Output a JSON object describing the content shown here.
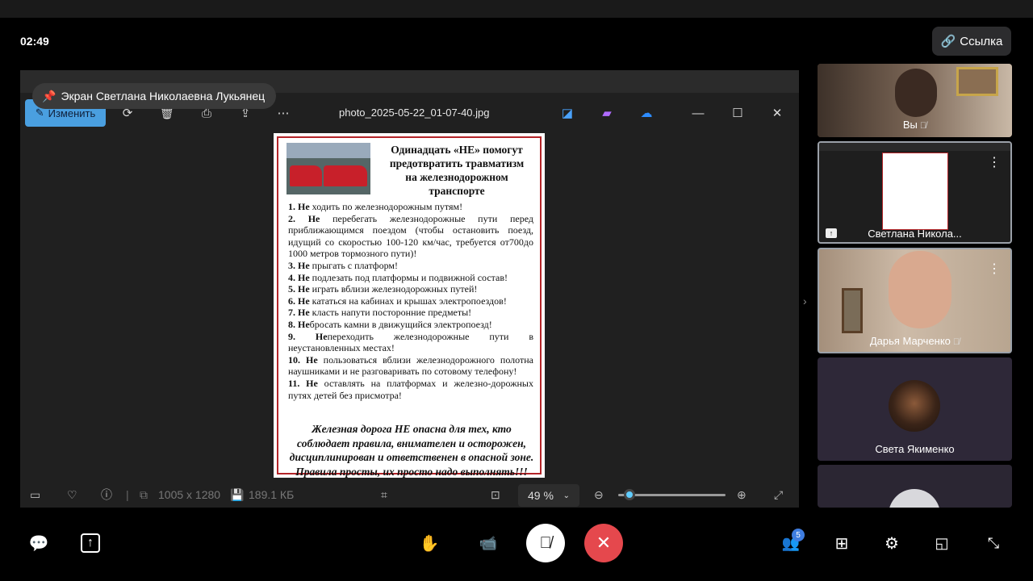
{
  "call": {
    "elapsed_time": "02:49",
    "link_button_label": "Ссылка",
    "screen_share_label": "Экран Светлана Николаевна Лукьянец"
  },
  "viewer": {
    "edit_label": "Изменить",
    "file_name": "photo_2025-05-22_01-07-40.jpg",
    "dimensions": "1005 x 1280",
    "file_size": "189.1 КБ",
    "zoom": "49 %",
    "zoom_slider_fraction": 0.05
  },
  "poster": {
    "title_lines": [
      "Одинадцать «НЕ» помогут",
      "предотвратить травматизм",
      "на железнодорожном",
      "транспорте"
    ],
    "rules": [
      {
        "num": "1.",
        "bold": "Не",
        "text": " ходить по железнодорожным путям!"
      },
      {
        "num": "2.",
        "bold": "Не",
        "text": " перебегать железнодорожные пути перед приближающимся поездом (чтобы остановить поезд, идущий со скоростью 100-120 км/час, требуется от700до 1000 метров тормозного пути)!"
      },
      {
        "num": "3.",
        "bold": "Не",
        "text": " прыгать с платформ!"
      },
      {
        "num": "4.",
        "bold": "Не",
        "text": " подлезать под платформы и подвижной состав!"
      },
      {
        "num": "5.",
        "bold": "Не",
        "text": " играть вблизи железнодорожных путей!"
      },
      {
        "num": "6.",
        "bold": "Не",
        "text": " кататься на кабинах и крышах электропоездов!"
      },
      {
        "num": "7.",
        "bold": "Не",
        "text": " класть напути посторонние предметы!"
      },
      {
        "num": "8.",
        "bold": "Не",
        "text": "бросать камни в движущийся электропоезд!"
      },
      {
        "num": "9.",
        "bold": "Не",
        "text": "переходить железнодорожные пути в неустановленных местах!"
      },
      {
        "num": "10.",
        "bold": "Не",
        "text": " пользоваться вблизи железнодорожного полотна наушниками и не разговаривать по сотовому телефону!"
      },
      {
        "num": "11.",
        "bold": "Не",
        "text": " оставлять на платформах и железно-дорожных путях детей без присмотра!"
      }
    ],
    "footer_lines": [
      "Железная дорога НЕ опасна для тех, кто",
      "соблюдает правила, внимателен и осторожен,",
      "дисциплинирован и ответственен в опасной зоне.",
      "Правила просты, их просто надо выполнять!!!"
    ]
  },
  "participants": [
    {
      "name": "Вы",
      "muted": true
    },
    {
      "name": "Светлана Никола...",
      "muted": false
    },
    {
      "name": "Дарья Марченко",
      "muted": true
    },
    {
      "name": "Света Якименко",
      "muted": false
    },
    {
      "name": "",
      "muted": false
    }
  ],
  "controls": {
    "participants_count": "5"
  },
  "colors": {
    "edit_button": "#4a9fe0",
    "end_call": "#e5484d",
    "badge": "#3f7de0",
    "poster_border": "#b32428"
  }
}
